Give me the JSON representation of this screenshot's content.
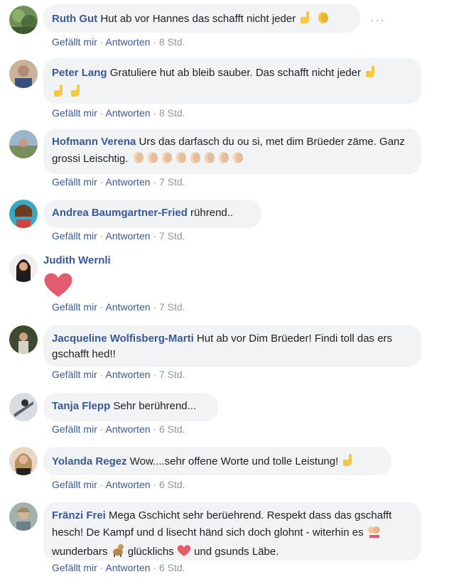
{
  "comments": [
    {
      "name": "Ruth Gut",
      "text": "Hut ab vor Hannes das schafft nicht jeder",
      "like": "Gefällt mir",
      "reply": "Antworten",
      "time": "8 Std."
    },
    {
      "name": "Peter Lang",
      "text": "Gratuliere hut ab bleib sauber. Das schafft nicht jeder",
      "like": "Gefällt mir",
      "reply": "Antworten",
      "time": "8 Std."
    },
    {
      "name": "Hofmann Verena",
      "text": "Urs das darfasch du ou si, met dim Brüeder zäme. Ganz grossi Leischtig.",
      "like": "Gefällt mir",
      "reply": "Antworten",
      "time": "7 Std."
    },
    {
      "name": "Andrea Baumgartner-Fried",
      "text": "rührend..",
      "like": "Gefällt mir",
      "reply": "Antworten",
      "time": "7 Std."
    },
    {
      "name": "Judith Wernli",
      "text": "",
      "like": "Gefällt mir",
      "reply": "Antworten",
      "time": "7 Std."
    },
    {
      "name": "Jacqueline Wolfisberg-Marti",
      "text": "Hut ab vor Dim Brüeder! Findi toll das ers gschafft hed!!",
      "like": "Gefällt mir",
      "reply": "Antworten",
      "time": "7 Std."
    },
    {
      "name": "Tanja Flepp",
      "text": "Sehr berührend...",
      "like": "Gefällt mir",
      "reply": "Antworten",
      "time": "6 Std."
    },
    {
      "name": "Yolanda Regez",
      "text": "Wow....sehr offene Worte und tolle Leistung!",
      "like": "Gefällt mir",
      "reply": "Antworten",
      "time": "6 Std."
    },
    {
      "name": "Fränzi Frei",
      "text_1": "Mega Gschicht sehr berüehrend. Respekt dass das gschafft hesch! De Kampf und d lisecht händ sich doch glohnt - witerhin es",
      "text_2": "wunderbars",
      "text_3": "glücklichs",
      "text_4": "und gsunds Läbe.",
      "like": "Gefällt mir",
      "reply": "Antworten",
      "time": "6 Std."
    }
  ],
  "more_label": "···",
  "separator": "·",
  "colors": {
    "link": "#385898",
    "bubble": "#f2f3f5",
    "meta": "#90949c",
    "heart": "#e0245e"
  },
  "icons": [
    "pointing-hand-icon",
    "clapping-hands-icon",
    "heart-icon",
    "kiss-couple-icon",
    "dog-icon",
    "heart-icon"
  ]
}
